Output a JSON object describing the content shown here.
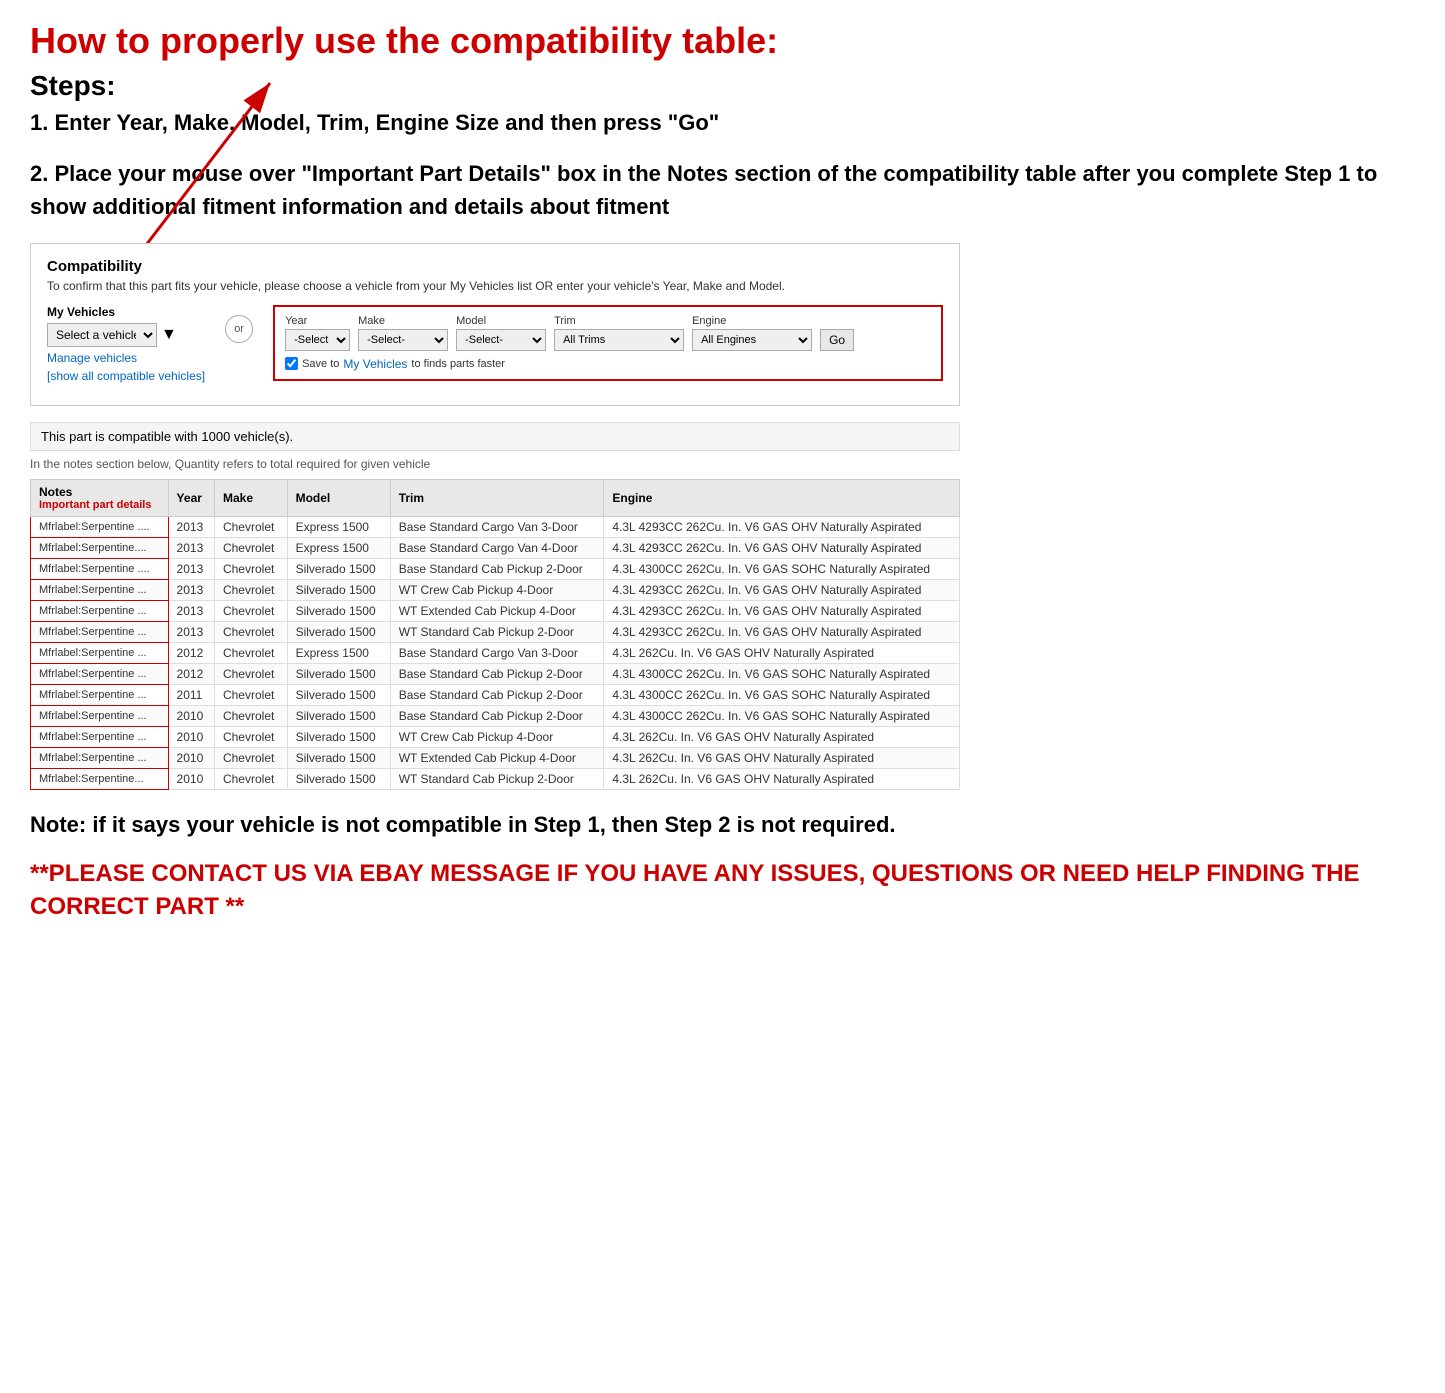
{
  "title": "How to properly use the compatibility table:",
  "steps_label": "Steps:",
  "step1": "1. Enter Year, Make, Model, Trim, Engine Size and then press \"Go\"",
  "step2": "2. Place your mouse over \"Important Part Details\" box in the Notes section of the compatibility table after you complete Step 1 to show additional fitment information and details about fitment",
  "compatibility": {
    "section_title": "Compatibility",
    "subtitle": "To confirm that this part fits your vehicle, please choose a vehicle from your My Vehicles list OR enter your vehicle's Year, Make and Model.",
    "my_vehicles_label": "My Vehicles",
    "select_vehicle_placeholder": "Select a vehicle",
    "or_label": "or",
    "manage_vehicles": "Manage vehicles",
    "show_all_link": "[show all compatible vehicles]",
    "year_label": "Year",
    "make_label": "Make",
    "model_label": "Model",
    "trim_label": "Trim",
    "engine_label": "Engine",
    "year_default": "-Select-",
    "make_default": "-Select-",
    "model_default": "-Select-",
    "trim_default": "All Trims",
    "engine_default": "All Engines",
    "go_label": "Go",
    "save_text": "Save to",
    "save_link": "My Vehicles",
    "save_suffix": "to finds parts faster",
    "compat_count": "This part is compatible with 1000 vehicle(s).",
    "compat_note": "In the notes section below, Quantity refers to total required for given vehicle",
    "table_headers": {
      "notes": "Notes",
      "important": "Important part details",
      "year": "Year",
      "make": "Make",
      "model": "Model",
      "trim": "Trim",
      "engine": "Engine"
    },
    "rows": [
      {
        "notes": "Mfrlabel:Serpentine ....",
        "year": "2013",
        "make": "Chevrolet",
        "model": "Express 1500",
        "trim": "Base Standard Cargo Van 3-Door",
        "engine": "4.3L 4293CC 262Cu. In. V6 GAS OHV Naturally Aspirated"
      },
      {
        "notes": "Mfrlabel:Serpentine....",
        "year": "2013",
        "make": "Chevrolet",
        "model": "Express 1500",
        "trim": "Base Standard Cargo Van 4-Door",
        "engine": "4.3L 4293CC 262Cu. In. V6 GAS OHV Naturally Aspirated"
      },
      {
        "notes": "Mfrlabel:Serpentine ....",
        "year": "2013",
        "make": "Chevrolet",
        "model": "Silverado 1500",
        "trim": "Base Standard Cab Pickup 2-Door",
        "engine": "4.3L 4300CC 262Cu. In. V6 GAS SOHC Naturally Aspirated"
      },
      {
        "notes": "Mfrlabel:Serpentine ...",
        "year": "2013",
        "make": "Chevrolet",
        "model": "Silverado 1500",
        "trim": "WT Crew Cab Pickup 4-Door",
        "engine": "4.3L 4293CC 262Cu. In. V6 GAS OHV Naturally Aspirated"
      },
      {
        "notes": "Mfrlabel:Serpentine ...",
        "year": "2013",
        "make": "Chevrolet",
        "model": "Silverado 1500",
        "trim": "WT Extended Cab Pickup 4-Door",
        "engine": "4.3L 4293CC 262Cu. In. V6 GAS OHV Naturally Aspirated"
      },
      {
        "notes": "Mfrlabel:Serpentine ...",
        "year": "2013",
        "make": "Chevrolet",
        "model": "Silverado 1500",
        "trim": "WT Standard Cab Pickup 2-Door",
        "engine": "4.3L 4293CC 262Cu. In. V6 GAS OHV Naturally Aspirated"
      },
      {
        "notes": "Mfrlabel:Serpentine ...",
        "year": "2012",
        "make": "Chevrolet",
        "model": "Express 1500",
        "trim": "Base Standard Cargo Van 3-Door",
        "engine": "4.3L 262Cu. In. V6 GAS OHV Naturally Aspirated"
      },
      {
        "notes": "Mfrlabel:Serpentine ...",
        "year": "2012",
        "make": "Chevrolet",
        "model": "Silverado 1500",
        "trim": "Base Standard Cab Pickup 2-Door",
        "engine": "4.3L 4300CC 262Cu. In. V6 GAS SOHC Naturally Aspirated"
      },
      {
        "notes": "Mfrlabel:Serpentine ...",
        "year": "2011",
        "make": "Chevrolet",
        "model": "Silverado 1500",
        "trim": "Base Standard Cab Pickup 2-Door",
        "engine": "4.3L 4300CC 262Cu. In. V6 GAS SOHC Naturally Aspirated"
      },
      {
        "notes": "Mfrlabel:Serpentine ...",
        "year": "2010",
        "make": "Chevrolet",
        "model": "Silverado 1500",
        "trim": "Base Standard Cab Pickup 2-Door",
        "engine": "4.3L 4300CC 262Cu. In. V6 GAS SOHC Naturally Aspirated"
      },
      {
        "notes": "Mfrlabel:Serpentine ...",
        "year": "2010",
        "make": "Chevrolet",
        "model": "Silverado 1500",
        "trim": "WT Crew Cab Pickup 4-Door",
        "engine": "4.3L 262Cu. In. V6 GAS OHV Naturally Aspirated"
      },
      {
        "notes": "Mfrlabel:Serpentine ...",
        "year": "2010",
        "make": "Chevrolet",
        "model": "Silverado 1500",
        "trim": "WT Extended Cab Pickup 4-Door",
        "engine": "4.3L 262Cu. In. V6 GAS OHV Naturally Aspirated"
      },
      {
        "notes": "Mfrlabel:Serpentine...",
        "year": "2010",
        "make": "Chevrolet",
        "model": "Silverado 1500",
        "trim": "WT Standard Cab Pickup 2-Door",
        "engine": "4.3L 262Cu. In. V6 GAS OHV Naturally Aspirated"
      }
    ]
  },
  "note_text": "Note: if it says your vehicle is not compatible in Step 1, then Step 2 is not required.",
  "contact_text": "**PLEASE CONTACT US VIA EBAY MESSAGE IF YOU HAVE ANY ISSUES, QUESTIONS OR NEED HELP FINDING THE CORRECT PART **"
}
